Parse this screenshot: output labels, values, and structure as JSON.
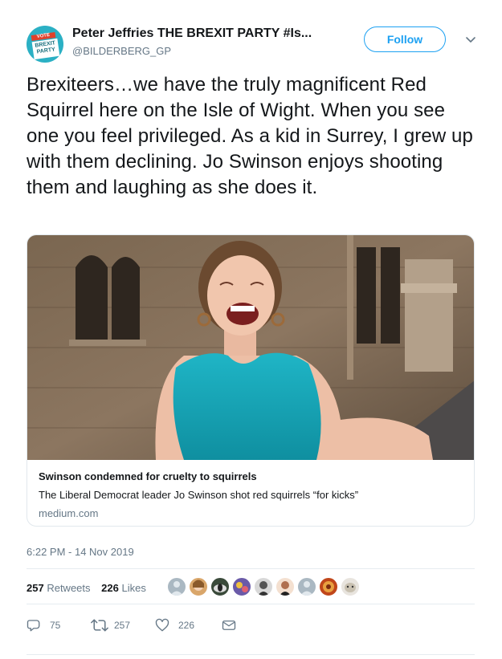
{
  "author": {
    "name": "Peter Jeffries THE BREXIT PARTY #Is...",
    "handle": "@BILDERBERG_GP",
    "avatar_badge_top": "VOTE",
    "avatar_badge_line1": "BREXIT",
    "avatar_badge_line2": "PARTY"
  },
  "follow_label": "Follow",
  "tweet_text": "Brexiteers…we have the truly magnificent Red Squirrel here on the Isle of Wight. When you see one you feel privileged. As a kid in Surrey, I grew up with them declining. Jo Swinson enjoys shooting them and laughing as she does it.",
  "card": {
    "title": "Swinson condemned for cruelty to squirrels",
    "description": "The Liberal Democrat leader Jo Swinson shot red squirrels “for kicks”",
    "domain": "medium.com"
  },
  "timestamp": "6:22 PM - 14 Nov 2019",
  "stats": {
    "retweets_count": "257",
    "retweets_label": "Retweets",
    "likes_count": "226",
    "likes_label": "Likes"
  },
  "actions": {
    "replies": "75",
    "retweets": "257",
    "likes": "226"
  },
  "colors": {
    "accent": "#1da1f2",
    "secondary_text": "#657786",
    "border": "#e1e8ed",
    "avatar_bg": "#2bb0c4"
  },
  "icons": [
    "reply-icon",
    "retweet-icon",
    "like-icon",
    "message-icon",
    "chevron-down-icon"
  ]
}
